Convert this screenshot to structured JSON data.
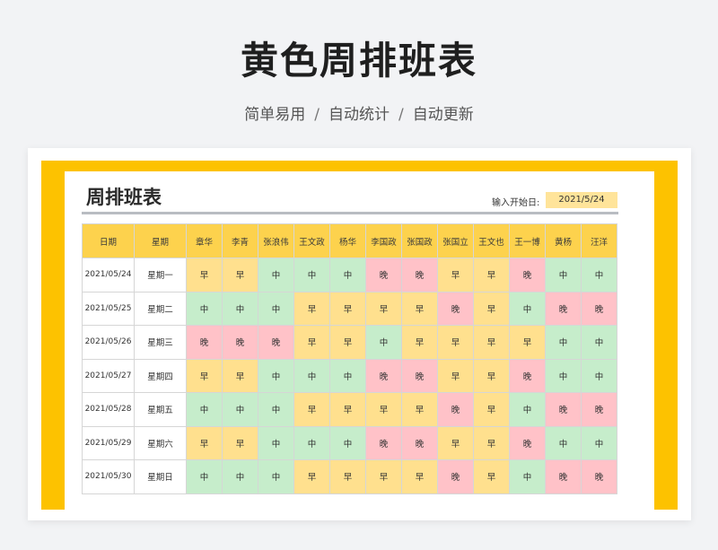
{
  "hero": {
    "title": "黄色周排班表",
    "tags": [
      "简单易用",
      "自动统计",
      "自动更新"
    ],
    "separator": "/"
  },
  "sheet": {
    "title": "周排班表",
    "start_label": "输入开始日:",
    "start_value": "2021/5/24"
  },
  "colors": {
    "frame": "#fdc200",
    "header": "#fdd24d",
    "early": "#ffe08e",
    "mid": "#c6edcb",
    "late": "#ffc2c8"
  },
  "table": {
    "date_header": "日期",
    "weekday_header": "星期",
    "staff": [
      "章华",
      "李青",
      "张浪伟",
      "王文政",
      "杨华",
      "李国政",
      "张国政",
      "张国立",
      "王文也",
      "王一博",
      "黄杨",
      "汪洋"
    ],
    "rows": [
      {
        "date": "2021/05/24",
        "weekday": "星期一",
        "shifts": [
          "早",
          "早",
          "中",
          "中",
          "中",
          "晚",
          "晚",
          "早",
          "早",
          "晚",
          "中",
          "中"
        ]
      },
      {
        "date": "2021/05/25",
        "weekday": "星期二",
        "shifts": [
          "中",
          "中",
          "中",
          "早",
          "早",
          "早",
          "早",
          "晚",
          "早",
          "中",
          "晚",
          "晚"
        ]
      },
      {
        "date": "2021/05/26",
        "weekday": "星期三",
        "shifts": [
          "晚",
          "晚",
          "晚",
          "早",
          "早",
          "中",
          "早",
          "早",
          "早",
          "早",
          "中",
          "中"
        ]
      },
      {
        "date": "2021/05/27",
        "weekday": "星期四",
        "shifts": [
          "早",
          "早",
          "中",
          "中",
          "中",
          "晚",
          "晚",
          "早",
          "早",
          "晚",
          "中",
          "中"
        ]
      },
      {
        "date": "2021/05/28",
        "weekday": "星期五",
        "shifts": [
          "中",
          "中",
          "中",
          "早",
          "早",
          "早",
          "早",
          "晚",
          "早",
          "中",
          "晚",
          "晚"
        ]
      },
      {
        "date": "2021/05/29",
        "weekday": "星期六",
        "shifts": [
          "早",
          "早",
          "中",
          "中",
          "中",
          "晚",
          "晚",
          "早",
          "早",
          "晚",
          "中",
          "中"
        ]
      },
      {
        "date": "2021/05/30",
        "weekday": "星期日",
        "shifts": [
          "中",
          "中",
          "中",
          "早",
          "早",
          "早",
          "早",
          "晚",
          "早",
          "中",
          "晚",
          "晚"
        ]
      }
    ]
  }
}
